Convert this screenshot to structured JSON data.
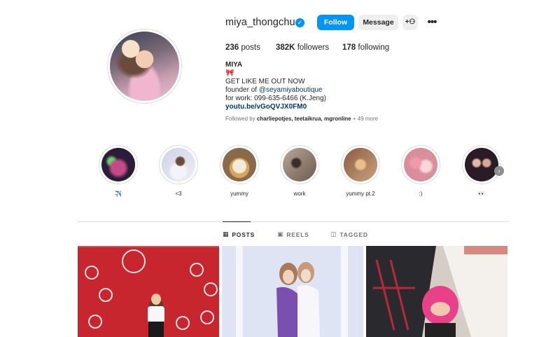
{
  "profile": {
    "username": "miya_thongchua",
    "verified_icon": "verified-badge-icon",
    "follow_label": "Follow",
    "message_label": "Message",
    "add_user_icon": "add-user-icon",
    "more_icon": "more-options-icon",
    "more_glyph": "•••",
    "add_user_glyph": "+⚇"
  },
  "stats": {
    "posts_count": "236",
    "posts_label": "posts",
    "followers_count": "382K",
    "followers_label": "followers",
    "following_count": "178",
    "following_label": "following"
  },
  "bio": {
    "name": "MIYA",
    "emoji": "🎀",
    "line1": "GET LIKE ME OUT NOW",
    "founder_prefix": "founder of ",
    "founder_mention": "@seyamiyaboutique",
    "work_line": "for work: 099-635-6466 (K.Jeng)",
    "link": "youtu.be/vGoQVJX0FM0"
  },
  "followed_by": {
    "prefix": "Followed by ",
    "users": "charliepotjes, teetaikrua, mgronline",
    "suffix": " + 49 more"
  },
  "highlights": [
    {
      "label": "✈️",
      "color": "#4a2e5a"
    },
    {
      "label": "<3",
      "color": "#d9dbe6"
    },
    {
      "label": "yummy",
      "color": "#c9a57a"
    },
    {
      "label": "work",
      "color": "#8a7868"
    },
    {
      "label": "yummy pt.2",
      "color": "#b78a6a"
    },
    {
      "label": ":)",
      "color": "#e7b6b6"
    },
    {
      "label": "👀",
      "color": "#3a2a35"
    }
  ],
  "tabs": {
    "posts": "POSTS",
    "reels": "REELS",
    "tagged": "TAGGED"
  },
  "colors": {
    "accent": "#0095f6",
    "link": "#00376b"
  }
}
